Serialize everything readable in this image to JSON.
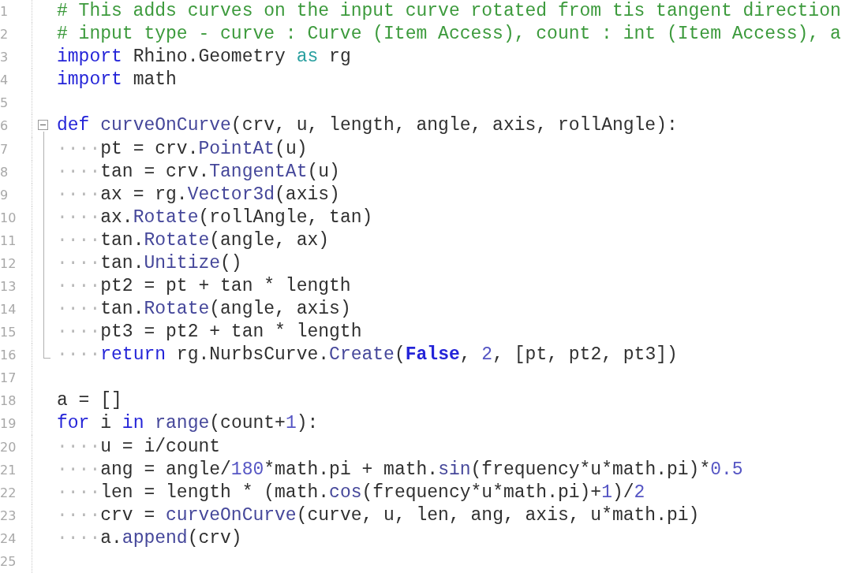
{
  "editor": {
    "lines": [
      {
        "number": "1",
        "tokens": [
          {
            "kind": "comment",
            "text": "# This adds curves on the input curve rotated from tis tangent direction"
          }
        ]
      },
      {
        "number": "2",
        "tokens": [
          {
            "kind": "comment",
            "text": "# input type - curve : Curve (Item Access), count : int (Item Access), a"
          }
        ]
      },
      {
        "number": "3",
        "tokens": [
          {
            "kind": "keyword",
            "text": "import"
          },
          {
            "kind": "plain",
            "text": " Rhino.Geometry "
          },
          {
            "kind": "keyword2",
            "text": "as"
          },
          {
            "kind": "plain",
            "text": " rg"
          }
        ]
      },
      {
        "number": "4",
        "tokens": [
          {
            "kind": "keyword",
            "text": "import"
          },
          {
            "kind": "plain",
            "text": " math"
          }
        ]
      },
      {
        "number": "5"
      },
      {
        "number": "6",
        "fold": {
          "kind": "start"
        },
        "expanded": true,
        "tokens": [
          {
            "kind": "keyword",
            "text": "def "
          },
          {
            "kind": "function",
            "text": "curveOnCurve"
          },
          {
            "kind": "plain",
            "text": "(crv, u, length, angle, axis, rollAngle):"
          }
        ]
      },
      {
        "number": "7",
        "fold": {
          "kind": "body"
        },
        "tokens": [
          {
            "kind": "whitespace",
            "text": "····"
          },
          {
            "kind": "plain",
            "text": "pt = crv."
          },
          {
            "kind": "function",
            "text": "PointAt"
          },
          {
            "kind": "plain",
            "text": "(u)"
          }
        ]
      },
      {
        "number": "8",
        "fold": {
          "kind": "body"
        },
        "tokens": [
          {
            "kind": "whitespace",
            "text": "····"
          },
          {
            "kind": "plain",
            "text": "tan = crv."
          },
          {
            "kind": "function",
            "text": "TangentAt"
          },
          {
            "kind": "plain",
            "text": "(u)"
          }
        ]
      },
      {
        "number": "9",
        "fold": {
          "kind": "body"
        },
        "tokens": [
          {
            "kind": "whitespace",
            "text": "····"
          },
          {
            "kind": "plain",
            "text": "ax = rg."
          },
          {
            "kind": "function",
            "text": "Vector3d"
          },
          {
            "kind": "plain",
            "text": "(axis)"
          }
        ]
      },
      {
        "number": "10",
        "fold": {
          "kind": "body"
        },
        "tokens": [
          {
            "kind": "whitespace",
            "text": "····"
          },
          {
            "kind": "plain",
            "text": "ax."
          },
          {
            "kind": "function",
            "text": "Rotate"
          },
          {
            "kind": "plain",
            "text": "(rollAngle, tan)"
          }
        ]
      },
      {
        "number": "11",
        "fold": {
          "kind": "body"
        },
        "tokens": [
          {
            "kind": "whitespace",
            "text": "····"
          },
          {
            "kind": "plain",
            "text": "tan."
          },
          {
            "kind": "function",
            "text": "Rotate"
          },
          {
            "kind": "plain",
            "text": "(angle, ax)"
          }
        ]
      },
      {
        "number": "12",
        "fold": {
          "kind": "body"
        },
        "tokens": [
          {
            "kind": "whitespace",
            "text": "····"
          },
          {
            "kind": "plain",
            "text": "tan."
          },
          {
            "kind": "function",
            "text": "Unitize"
          },
          {
            "kind": "plain",
            "text": "()"
          }
        ]
      },
      {
        "number": "13",
        "fold": {
          "kind": "body"
        },
        "tokens": [
          {
            "kind": "whitespace",
            "text": "····"
          },
          {
            "kind": "plain",
            "text": "pt2 = pt + tan * length"
          }
        ]
      },
      {
        "number": "14",
        "fold": {
          "kind": "body"
        },
        "tokens": [
          {
            "kind": "whitespace",
            "text": "····"
          },
          {
            "kind": "plain",
            "text": "tan."
          },
          {
            "kind": "function",
            "text": "Rotate"
          },
          {
            "kind": "plain",
            "text": "(angle, axis)"
          }
        ]
      },
      {
        "number": "15",
        "fold": {
          "kind": "body"
        },
        "tokens": [
          {
            "kind": "whitespace",
            "text": "····"
          },
          {
            "kind": "plain",
            "text": "pt3 = pt2 + tan * length"
          }
        ]
      },
      {
        "number": "16",
        "fold": {
          "kind": "end"
        },
        "tokens": [
          {
            "kind": "whitespace",
            "text": "····"
          },
          {
            "kind": "keyword",
            "text": "return"
          },
          {
            "kind": "plain",
            "text": " rg.NurbsCurve."
          },
          {
            "kind": "function",
            "text": "Create"
          },
          {
            "kind": "plain",
            "text": "("
          },
          {
            "kind": "constant",
            "text": "False"
          },
          {
            "kind": "plain",
            "text": ", "
          },
          {
            "kind": "number",
            "text": "2"
          },
          {
            "kind": "plain",
            "text": ", [pt, pt2, pt3])"
          }
        ]
      },
      {
        "number": "17"
      },
      {
        "number": "18",
        "tokens": [
          {
            "kind": "plain",
            "text": "a = []"
          }
        ]
      },
      {
        "number": "19",
        "tokens": [
          {
            "kind": "keyword",
            "text": "for"
          },
          {
            "kind": "plain",
            "text": " i "
          },
          {
            "kind": "keyword",
            "text": "in "
          },
          {
            "kind": "function",
            "text": "range"
          },
          {
            "kind": "plain",
            "text": "(count+"
          },
          {
            "kind": "number",
            "text": "1"
          },
          {
            "kind": "plain",
            "text": "):"
          }
        ]
      },
      {
        "number": "20",
        "tokens": [
          {
            "kind": "whitespace",
            "text": "····"
          },
          {
            "kind": "plain",
            "text": "u = i/count"
          }
        ]
      },
      {
        "number": "21",
        "tokens": [
          {
            "kind": "whitespace",
            "text": "····"
          },
          {
            "kind": "plain",
            "text": "ang = angle/"
          },
          {
            "kind": "number",
            "text": "180"
          },
          {
            "kind": "plain",
            "text": "*math.pi + math."
          },
          {
            "kind": "function",
            "text": "sin"
          },
          {
            "kind": "plain",
            "text": "(frequency*u*math.pi)*"
          },
          {
            "kind": "number",
            "text": "0.5"
          }
        ]
      },
      {
        "number": "22",
        "tokens": [
          {
            "kind": "whitespace",
            "text": "····"
          },
          {
            "kind": "plain",
            "text": "len = length * (math."
          },
          {
            "kind": "function",
            "text": "cos"
          },
          {
            "kind": "plain",
            "text": "(frequency*u*math.pi)+"
          },
          {
            "kind": "number",
            "text": "1"
          },
          {
            "kind": "plain",
            "text": ")/"
          },
          {
            "kind": "number",
            "text": "2"
          }
        ]
      },
      {
        "number": "23",
        "tokens": [
          {
            "kind": "whitespace",
            "text": "····"
          },
          {
            "kind": "plain",
            "text": "crv = "
          },
          {
            "kind": "function",
            "text": "curveOnCurve"
          },
          {
            "kind": "plain",
            "text": "(curve, u, len, ang, axis, u*math.pi)"
          }
        ]
      },
      {
        "number": "24",
        "tokens": [
          {
            "kind": "whitespace",
            "text": "····"
          },
          {
            "kind": "plain",
            "text": "a."
          },
          {
            "kind": "function",
            "text": "append"
          },
          {
            "kind": "plain",
            "text": "(crv)"
          }
        ]
      },
      {
        "number": "25"
      }
    ]
  }
}
